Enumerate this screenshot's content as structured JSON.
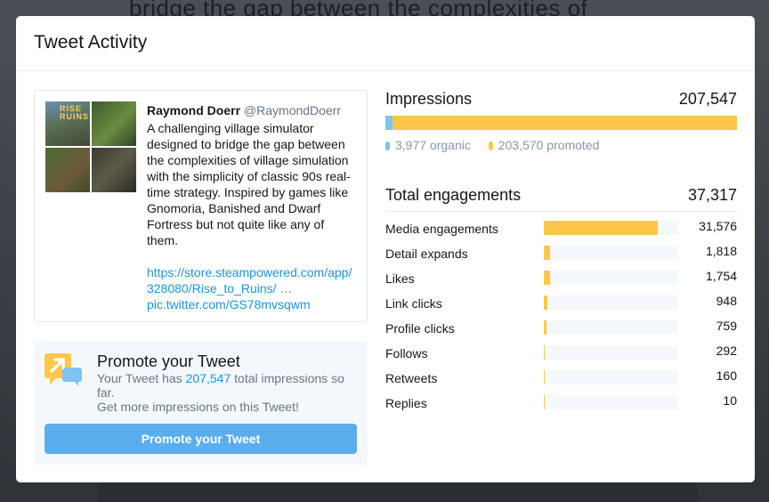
{
  "background": {
    "tweet_text_fragment": "bridge the gap between the complexities of"
  },
  "modal": {
    "title": "Tweet Activity"
  },
  "tweet": {
    "thumb_logo": "RISE RUINS",
    "author_name": "Raymond Doerr",
    "author_handle": "@RaymondDoerr",
    "text": "A challenging village simulator designed to bridge the gap between the complexities of village simulation with the simplicity of classic 90s real-time strategy. Inspired by games like Gnomoria, Banished and Dwarf Fortress but not quite like any of them.",
    "link_line1": "https://store.steampowered.com/app/",
    "link_line2": "328080/Rise_to_Ruins/ …",
    "link_line3": "pic.twitter.com/GS78mvsqwm"
  },
  "promo": {
    "title": "Promote your Tweet",
    "desc_prefix": "Your Tweet has ",
    "desc_number": "207,547",
    "desc_suffix": " total impressions so far.",
    "sub": "Get more impressions on this Tweet!",
    "button_label": "Promote your Tweet",
    "icon": "megaphone-arrow-icon"
  },
  "impressions": {
    "label": "Impressions",
    "total": "207,547",
    "organic_label": "3,977 organic",
    "promoted_label": "203,570 promoted",
    "organic_fraction": 0.0192,
    "colors": {
      "organic": "#7ec3f2",
      "promoted": "#fcc74a"
    }
  },
  "engagements": {
    "label": "Total engagements",
    "total": "37,317",
    "scale_max": 37317,
    "rows": [
      {
        "name": "Media engagements",
        "display": "31,576",
        "value": 31576
      },
      {
        "name": "Detail expands",
        "display": "1,818",
        "value": 1818
      },
      {
        "name": "Likes",
        "display": "1,754",
        "value": 1754
      },
      {
        "name": "Link clicks",
        "display": "948",
        "value": 948
      },
      {
        "name": "Profile clicks",
        "display": "759",
        "value": 759
      },
      {
        "name": "Follows",
        "display": "292",
        "value": 292
      },
      {
        "name": "Retweets",
        "display": "160",
        "value": 160
      },
      {
        "name": "Replies",
        "display": "10",
        "value": 10
      }
    ]
  }
}
